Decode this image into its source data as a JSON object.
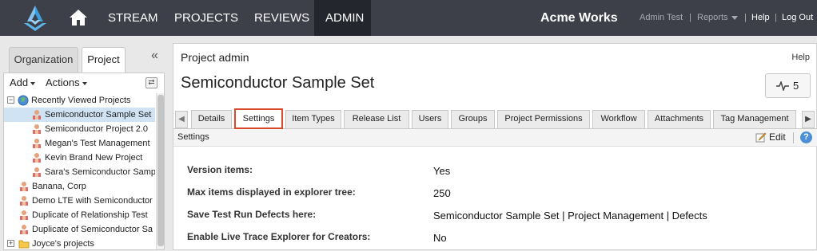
{
  "nav": {
    "items": [
      "STREAM",
      "PROJECTS",
      "REVIEWS",
      "ADMIN"
    ],
    "brand": "Acme Works",
    "user": "Admin Test",
    "reports": "Reports",
    "help": "Help",
    "logout": "Log Out",
    "separator": "|"
  },
  "left": {
    "tabs": [
      "Organization",
      "Project"
    ],
    "add": "Add",
    "actions": "Actions",
    "collapse": "«",
    "tree": [
      {
        "label": "Recently Viewed Projects",
        "icon": "globe-icon",
        "expander": "−",
        "level": 0
      },
      {
        "label": "Semiconductor Sample Set",
        "icon": "project-icon",
        "level": 1,
        "selected": true
      },
      {
        "label": "Semiconductor Project 2.0",
        "icon": "project-icon",
        "level": 1
      },
      {
        "label": "Megan's Test Management",
        "icon": "project-icon",
        "level": 1
      },
      {
        "label": "Kevin Brand New Project",
        "icon": "project-icon",
        "level": 1
      },
      {
        "label": "Sara's Semiconductor Samp",
        "icon": "project-icon",
        "level": 1
      },
      {
        "label": "Banana, Corp",
        "icon": "project-icon",
        "level": 0
      },
      {
        "label": "Demo LTE with Semiconductor",
        "icon": "project-icon",
        "level": 0
      },
      {
        "label": "Duplicate of Relationship Test",
        "icon": "project-icon",
        "level": 0
      },
      {
        "label": "Duplicate of Semiconductor Sa",
        "icon": "project-icon",
        "level": 0
      },
      {
        "label": "Joyce's projects",
        "icon": "folder-icon",
        "expander": "+",
        "level": 0
      }
    ]
  },
  "main": {
    "header": "Project admin",
    "help": "Help",
    "title": "Semiconductor Sample Set",
    "pulse_count": "5",
    "tabs": [
      "Details",
      "Settings",
      "Item Types",
      "Release List",
      "Users",
      "Groups",
      "Project Permissions",
      "Workflow",
      "Attachments",
      "Tag Management"
    ],
    "active_tab": "Settings",
    "section_title": "Settings",
    "edit": "Edit",
    "fields": [
      {
        "label": "Version items:",
        "value": "Yes"
      },
      {
        "label": "Max items displayed in explorer tree:",
        "value": "250"
      },
      {
        "label": "Save Test Run Defects here:",
        "value": "Semiconductor Sample Set | Project Management | Defects"
      },
      {
        "label": "Enable Live Trace Explorer for Creators:",
        "value": "No"
      }
    ]
  },
  "colors": {
    "nav_bg": "#3d3f49",
    "nav_active": "#24262e",
    "active_tab_border": "#d9492b",
    "selection": "#cfe3f5"
  }
}
